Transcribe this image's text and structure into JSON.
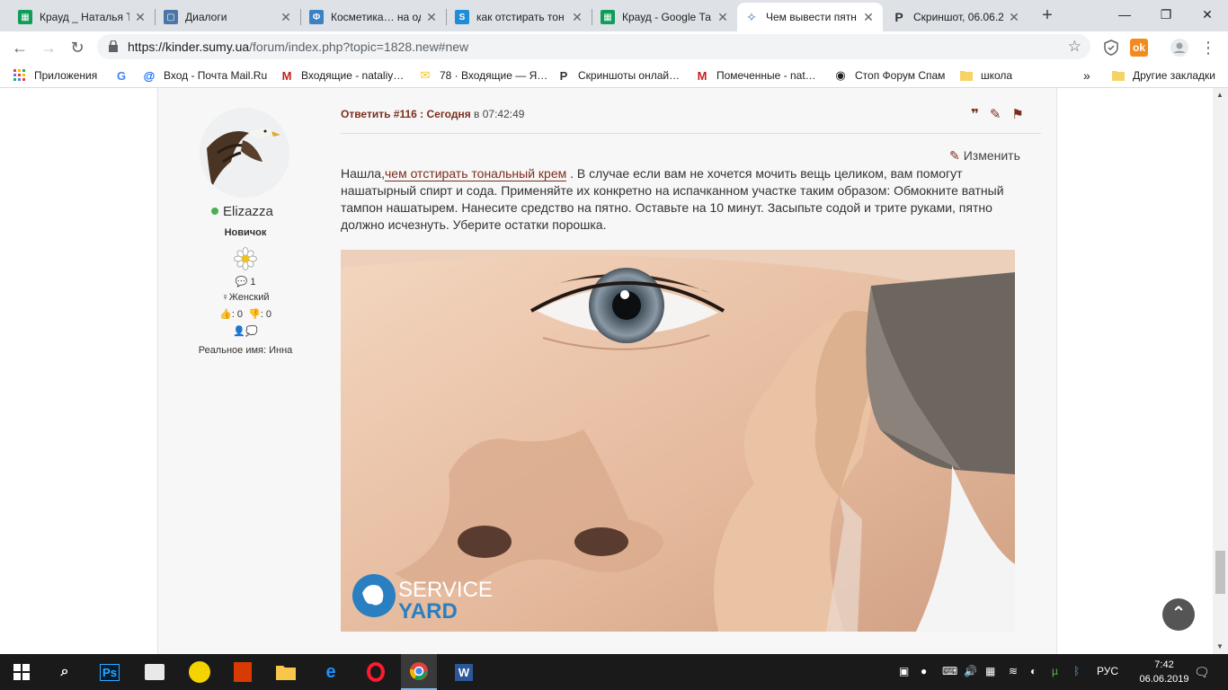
{
  "browser": {
    "tabs": [
      {
        "title": "Крауд _ Наталья Т",
        "icon": "sheets-icon",
        "color": "#0f9d58"
      },
      {
        "title": "Диалоги",
        "icon": "chat-icon",
        "color": "#4a76a8"
      },
      {
        "title": "Косметика… на од",
        "icon": "ru-icon",
        "color": "#3b82c4"
      },
      {
        "title": "как отстирать тон",
        "icon": "s-icon",
        "color": "#1f8dd6"
      },
      {
        "title": "Крауд - Google Та",
        "icon": "sheets-icon",
        "color": "#0f9d58"
      },
      {
        "title": "Чем вывести пятн",
        "icon": "swirl-icon",
        "color": "#4a76a8",
        "active": true
      },
      {
        "title": "Скриншот, 06.06.2",
        "icon": "p-icon",
        "color": "#333333"
      }
    ],
    "new_tab": "+",
    "url_host": "https://kinder.sumy.ua",
    "url_path": "/forum/index.php?topic=1828.new#new"
  },
  "bookmarks": [
    {
      "label": "Приложения",
      "icon": "apps-icon"
    },
    {
      "label": "",
      "icon": "google-icon"
    },
    {
      "label": "Вход - Почта Mail.Ru",
      "icon": "mailru-icon"
    },
    {
      "label": "Входящие - nataliy…",
      "icon": "gmail-icon"
    },
    {
      "label": "78 · Входящие — Я…",
      "icon": "yandex-mail-icon"
    },
    {
      "label": "Скриншоты онлай…",
      "icon": "p-icon"
    },
    {
      "label": "Помеченные - nat…",
      "icon": "gmail-icon"
    },
    {
      "label": "Стоп Форум Спам",
      "icon": "stop-icon"
    },
    {
      "label": "школа",
      "icon": "folder-icon"
    },
    {
      "label": "»",
      "icon": ""
    },
    {
      "label": "Другие закладки",
      "icon": "folder-icon"
    }
  ],
  "user": {
    "name": "Elizazza",
    "rank": "Новичок",
    "posts": "1",
    "gender": "Женский",
    "likes": ": 0",
    "dislikes": ": 0",
    "real_name": "Реальное имя: Инна"
  },
  "post": {
    "reply_label": "Ответить #116 : Сегодня",
    "time": " в 07:42:49",
    "edit_label": "Изменить",
    "text_before": "Нашла,",
    "link_text": "чем отстирать тональный крем",
    "text_after": " . В случае если вам не хочется мочить вещь целиком, вам помогут нашатырный спирт и сода. Применяйте их конкретно на испачканном участке таким образом: Обмокните ватный тампон нашатырем. Нанесите средство на пятно. Оставьте на 10 минут. Засыпьте содой и трите руками, пятно должно исчезнуть. Уберите остатки порошка.",
    "watermark_line1": "SERVICE",
    "watermark_line2": "YARD"
  },
  "taskbar": {
    "lang": "РУС",
    "time": "7:42",
    "date": "06.06.2019"
  },
  "colors": {
    "accent": "#7b2e1d",
    "online": "#4caf50"
  }
}
